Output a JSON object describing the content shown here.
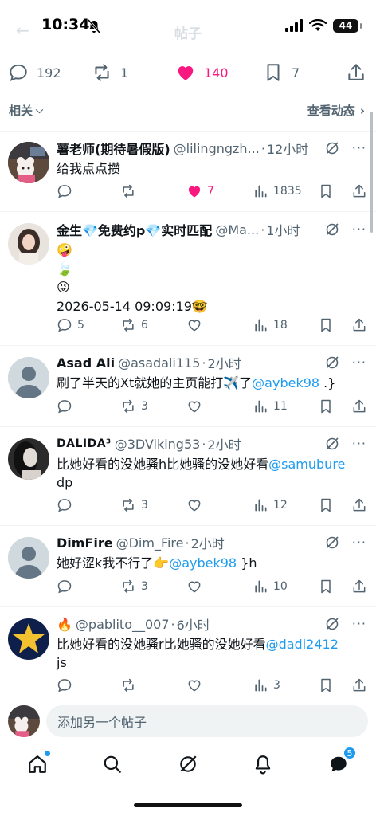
{
  "status": {
    "time": "10:34",
    "battery": "44"
  },
  "header": {
    "title": "帖子"
  },
  "top_actions": {
    "replies": "192",
    "reposts": "1",
    "likes": "140",
    "bookmarks": "7"
  },
  "filter": {
    "left_label": "相关",
    "right_label": "查看动态"
  },
  "posts": [
    {
      "name": "薯老师(期待暑假版)",
      "handle": "@lilingngzh...",
      "time": "12小时",
      "text": "给我点点攒",
      "replies": "",
      "reposts": "",
      "likes": "7",
      "views": "1835"
    },
    {
      "name": "金生💎免费约p💎实时匹配",
      "handle": "@Ma...",
      "time": "1小时",
      "text_lines": [
        "🤪",
        "🍃",
        "😜",
        "2026-05-14 09:09:19🤓"
      ],
      "replies": "5",
      "reposts": "6",
      "likes": "",
      "views": "18"
    },
    {
      "name": "Asad Ali",
      "handle": "@asadali115",
      "time": "2小时",
      "text": "刷了半天的Xt就她的主页能打✈️了",
      "mention": "@aybek98",
      "text_after": " .}",
      "replies": "",
      "reposts": "3",
      "likes": "",
      "views": "11"
    },
    {
      "name": "DALIDA³",
      "handle": "@3DViking53",
      "time": "2小时",
      "text": "比她好看的没她骚h比她骚的没她好看",
      "mention": "@samubure",
      "text_after": "dp",
      "replies": "",
      "reposts": "3",
      "likes": "",
      "views": "12"
    },
    {
      "name": "DimFire",
      "handle": "@Dim_Fire",
      "time": "2小时",
      "text": "她好涩k我不行了👉",
      "mention": "@aybek98",
      "text_after": " }h",
      "replies": "",
      "reposts": "3",
      "likes": "",
      "views": "10"
    },
    {
      "name": "🔥",
      "handle": "@pablito__007",
      "time": "6小时",
      "text": "比她好看的没她骚r比她骚的没她好看",
      "mention": "@dadi2412",
      "text_after": "js",
      "replies": "",
      "reposts": "",
      "likes": "",
      "views": "3"
    }
  ],
  "reply_bar": {
    "placeholder": "添加另一个帖子"
  },
  "tabbar": {
    "messages_badge": "5"
  },
  "colors": {
    "accent": "#1d9bf0",
    "like": "#f91880",
    "text": "#0f1419",
    "muted": "#536471"
  }
}
